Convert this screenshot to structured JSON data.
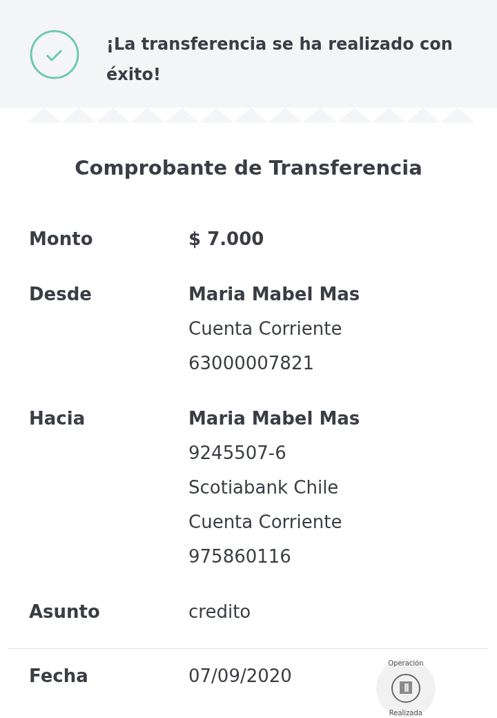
{
  "banner": {
    "message": "¡La transferencia se ha realizado con éxito!",
    "success": true
  },
  "receipt": {
    "title": "Comprobante de Transferencia",
    "rows": [
      {
        "label": "Monto",
        "lines": [
          "$ 7.000"
        ],
        "highlight": true
      },
      {
        "label": "Desde",
        "lines": [
          "Maria Mabel Mas",
          "Cuenta Corriente",
          "63000007821"
        ],
        "highlight": true
      },
      {
        "label": "Hacia",
        "lines": [
          "Maria Mabel Mas",
          "9245507-6",
          "Scotiabank Chile",
          "Cuenta Corriente",
          "975860116"
        ],
        "highlight": true
      },
      {
        "label": "Asunto",
        "lines": [
          "credito"
        ],
        "highlight": false
      }
    ],
    "footer_row": {
      "label": "Fecha",
      "lines": [
        "07/09/2020"
      ],
      "highlight": false
    },
    "stamp": {
      "top_text": "Operación",
      "bottom_text": "Realizada"
    }
  }
}
